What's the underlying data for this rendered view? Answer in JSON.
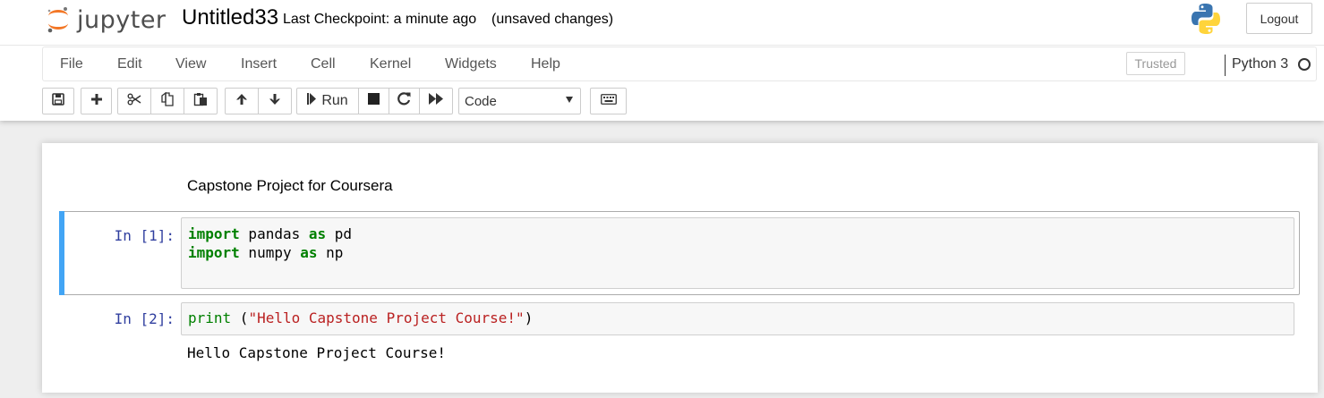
{
  "header": {
    "logo_text": "jupyter",
    "notebook_name": "Untitled33",
    "checkpoint": "Last Checkpoint: a minute ago",
    "autosave_status": "(unsaved changes)",
    "logout_label": "Logout"
  },
  "menubar": {
    "items": [
      "File",
      "Edit",
      "View",
      "Insert",
      "Cell",
      "Kernel",
      "Widgets",
      "Help"
    ],
    "trusted_label": "Trusted",
    "kernel_name": "Python 3"
  },
  "toolbar": {
    "run_label": "Run",
    "cell_type": "Code",
    "icons": [
      "save-icon",
      "plus-icon",
      "cut-icon",
      "copy-icon",
      "paste-icon",
      "arrow-up-icon",
      "arrow-down-icon",
      "step-forward-icon",
      "stop-icon",
      "restart-icon",
      "fast-forward-icon",
      "keyboard-icon"
    ]
  },
  "notebook": {
    "markdown_text": "Capstone Project for Coursera",
    "cells": [
      {
        "prompt": "In [1]:",
        "lines": [
          {
            "kw1": "import",
            "mid": " pandas ",
            "kw2": "as",
            "tail": " pd"
          },
          {
            "kw1": "import",
            "mid": " numpy ",
            "kw2": "as",
            "tail": " np"
          }
        ]
      },
      {
        "prompt": "In [2]:",
        "fn": "print",
        "open": " (",
        "str": "\"Hello Capstone Project Course!\"",
        "close": ")",
        "output": "Hello Capstone Project Course!"
      }
    ]
  },
  "colors": {
    "selected_cell_bar": "#42a5f5",
    "prompt": "#303f9f",
    "keyword": "#008000",
    "string": "#ba2121"
  }
}
